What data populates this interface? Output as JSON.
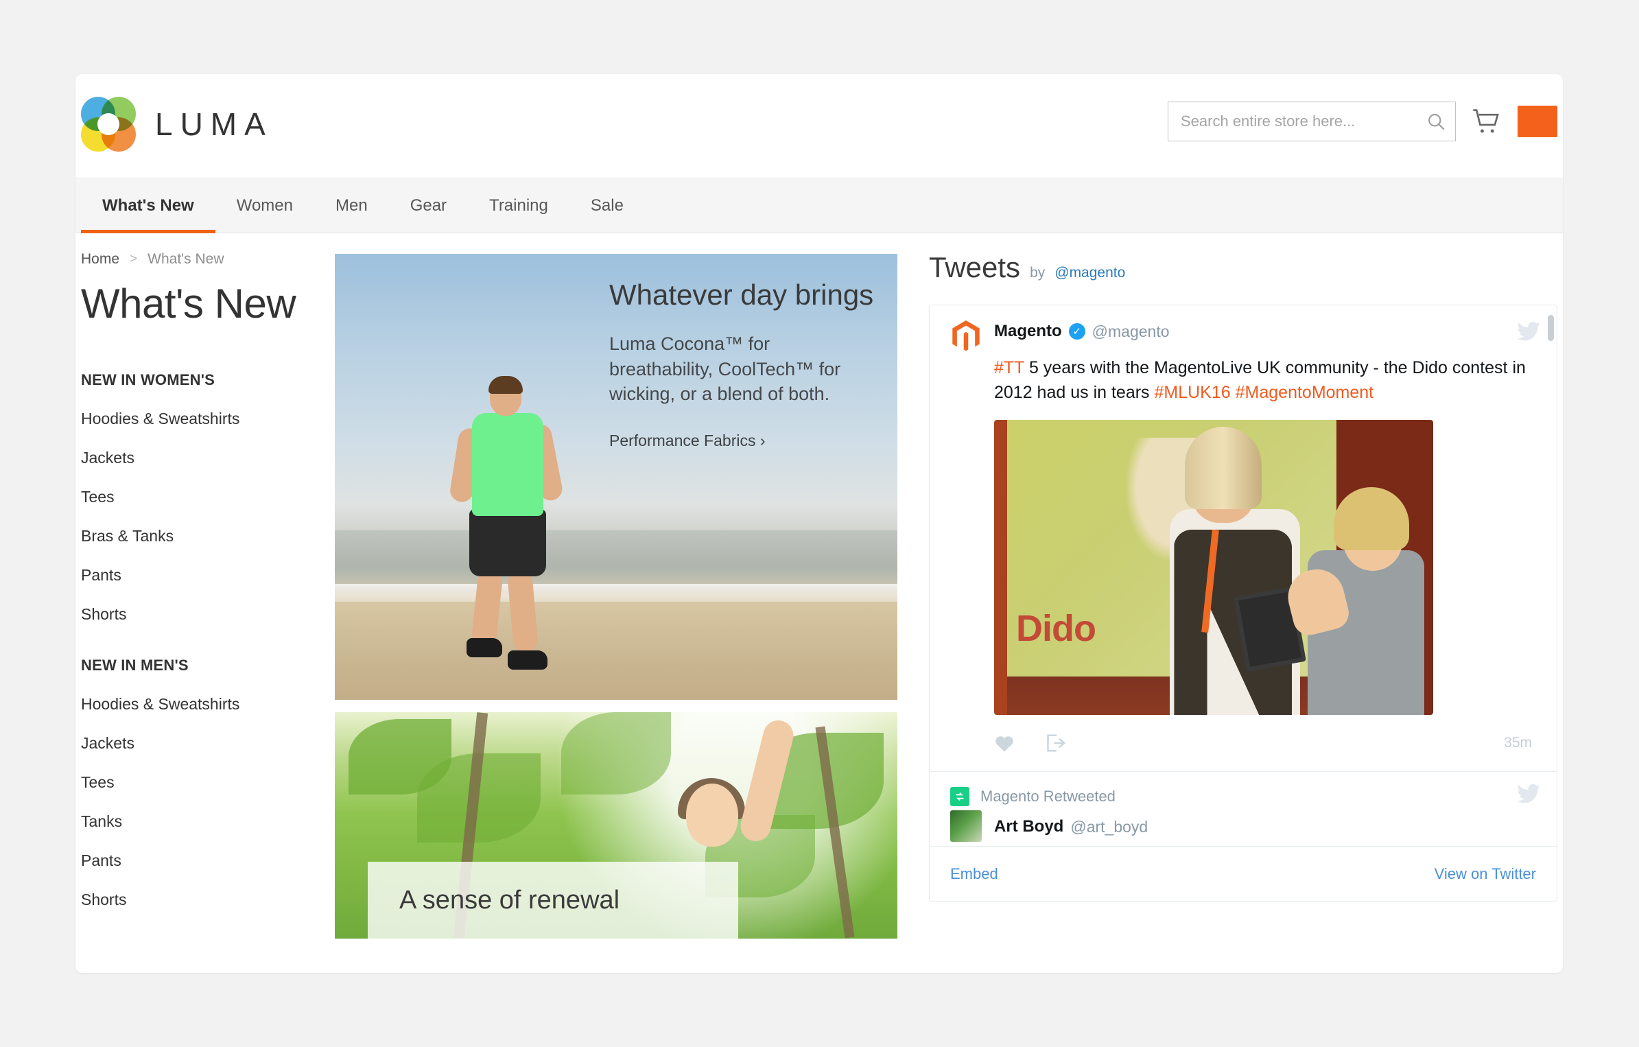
{
  "header": {
    "logo_text": "LUMA",
    "logo_colors": {
      "blue": "#2f9fdc",
      "green": "#7fc242",
      "yellow": "#f4d70a",
      "orange": "#ef7d22"
    },
    "search": {
      "placeholder": "Search entire store here...",
      "value": ""
    },
    "cart_icon": "shopping-cart-icon",
    "accent_color": "#f4611a"
  },
  "nav": {
    "items": [
      {
        "label": "What's New",
        "active": true
      },
      {
        "label": "Women",
        "active": false
      },
      {
        "label": "Men",
        "active": false
      },
      {
        "label": "Gear",
        "active": false
      },
      {
        "label": "Training",
        "active": false
      },
      {
        "label": "Sale",
        "active": false
      }
    ]
  },
  "breadcrumb": {
    "home": "Home",
    "separator": ">",
    "current": "What's New"
  },
  "page": {
    "title": "What's New"
  },
  "sidebar": {
    "groups": [
      {
        "heading": "NEW IN WOMEN'S",
        "links": [
          "Hoodies & Sweatshirts",
          "Jackets",
          "Tees",
          "Bras & Tanks",
          "Pants",
          "Shorts"
        ]
      },
      {
        "heading": "NEW IN MEN'S",
        "links": [
          "Hoodies & Sweatshirts",
          "Jackets",
          "Tees",
          "Tanks",
          "Pants",
          "Shorts"
        ]
      }
    ]
  },
  "banners": {
    "hero": {
      "heading": "Whatever day brings",
      "body": "Luma Cocona™ for breathability, CoolTech™ for wicking, or a blend of both.",
      "cta": "Performance Fabrics ›"
    },
    "renewal": {
      "heading": "A sense of renewal"
    }
  },
  "tweets": {
    "title": "Tweets",
    "by_label": "by",
    "handle": "@magento",
    "items": [
      {
        "name": "Magento",
        "verified": true,
        "handle": "@magento",
        "text_parts": [
          {
            "t": "#TT",
            "hash": true
          },
          {
            "t": " 5 years with the MagentoLive UK community - the Dido contest in 2012 had us in tears ",
            "hash": false
          },
          {
            "t": "#MLUK16",
            "hash": true
          },
          {
            "t": " ",
            "hash": false
          },
          {
            "t": "#MagentoMoment",
            "hash": true
          }
        ],
        "photo_caption": "Dido",
        "time": "35m",
        "actions": [
          "heart-icon",
          "share-icon"
        ]
      }
    ],
    "retweet_notice": "Magento Retweeted",
    "retweeted": {
      "name": "Art Boyd",
      "handle": "@art_boyd"
    },
    "footer": {
      "embed": "Embed",
      "view": "View on Twitter"
    },
    "link_color": "#4a90d9",
    "hashtag_color": "#f05a1e"
  }
}
